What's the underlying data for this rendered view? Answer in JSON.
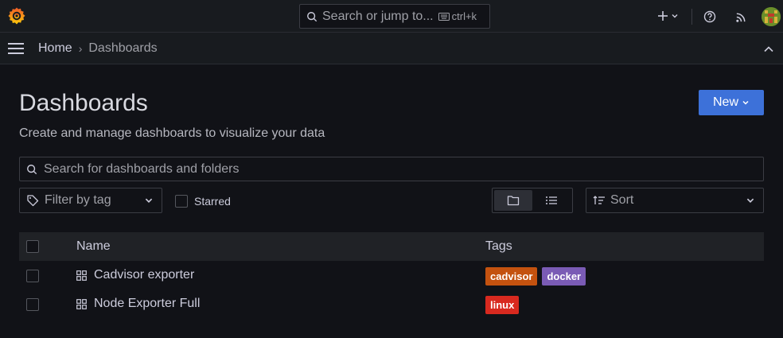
{
  "topbar": {
    "search_placeholder": "Search or jump to...",
    "shortcut": "ctrl+k",
    "add_icon": "plus-icon",
    "help_icon": "help-icon",
    "news_icon": "rss-icon"
  },
  "breadcrumb": {
    "home": "Home",
    "separator": "›",
    "current": "Dashboards"
  },
  "page": {
    "title": "Dashboards",
    "subtitle": "Create and manage dashboards to visualize your data",
    "new_button": "New"
  },
  "filters": {
    "search_placeholder": "Search for dashboards and folders",
    "tag_filter_placeholder": "Filter by tag",
    "starred_label": "Starred",
    "starred_checked": false,
    "view_mode": "folders",
    "sort_placeholder": "Sort"
  },
  "table": {
    "columns": {
      "name": "Name",
      "tags": "Tags"
    },
    "rows": [
      {
        "name": "Cadvisor exporter",
        "tags": [
          {
            "label": "cadvisor",
            "color": "#c4520f"
          },
          {
            "label": "docker",
            "color": "#7a5bb5"
          }
        ]
      },
      {
        "name": "Node Exporter Full",
        "tags": [
          {
            "label": "linux",
            "color": "#d8291f"
          }
        ]
      }
    ]
  },
  "colors": {
    "primary": "#3d71d9",
    "background": "#111217",
    "panel": "#181b1f"
  }
}
